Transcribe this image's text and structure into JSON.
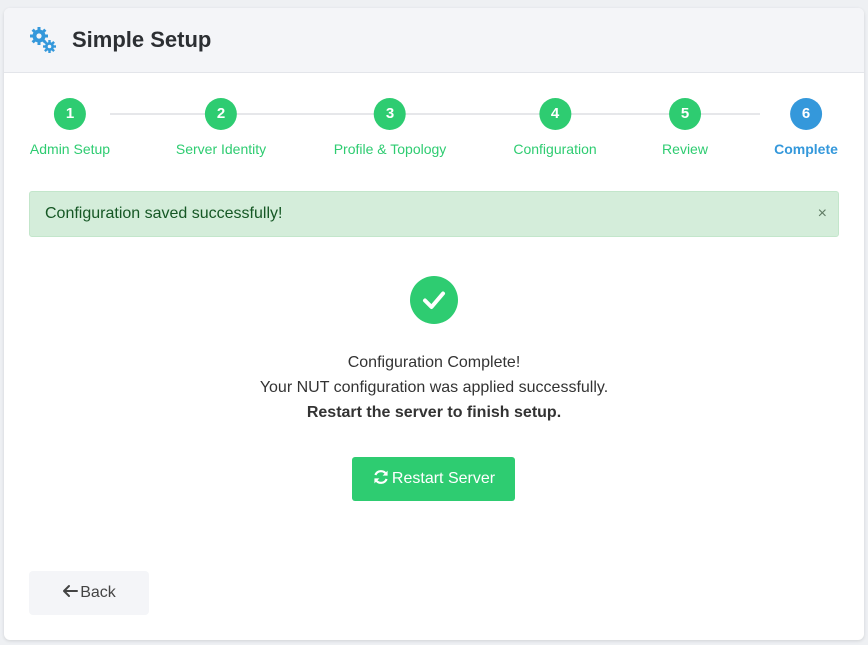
{
  "header": {
    "title": "Simple Setup",
    "icon": "gears-icon",
    "icon_color": "#3498db"
  },
  "stepper": {
    "steps": [
      {
        "number": "1",
        "label": "Admin Setup",
        "state": "done"
      },
      {
        "number": "2",
        "label": "Server Identity",
        "state": "done"
      },
      {
        "number": "3",
        "label": "Profile & Topology",
        "state": "done"
      },
      {
        "number": "4",
        "label": "Configuration",
        "state": "done"
      },
      {
        "number": "5",
        "label": "Review",
        "state": "done"
      },
      {
        "number": "6",
        "label": "Complete",
        "state": "active"
      }
    ]
  },
  "alert": {
    "message": "Configuration saved successfully!",
    "close_symbol": "×"
  },
  "complete": {
    "icon": "check-circle-icon",
    "heading": "Configuration Complete!",
    "detail": "Your NUT configuration was applied successfully.",
    "instruction": "Restart the server to finish setup."
  },
  "buttons": {
    "restart_label": "Restart Server",
    "back_label": "Back"
  },
  "colors": {
    "success": "#2ecc71",
    "active": "#3498db",
    "alert_bg": "#d4edda",
    "alert_text": "#155724"
  }
}
